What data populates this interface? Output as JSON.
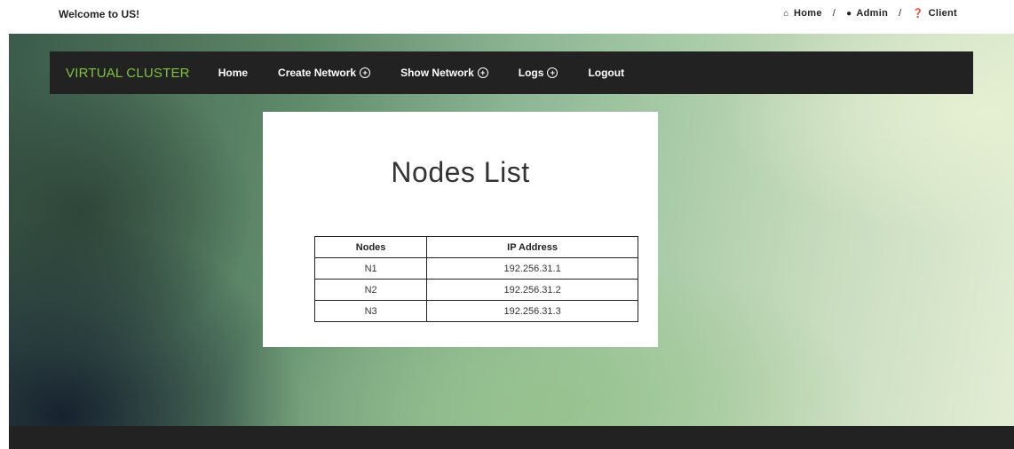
{
  "header": {
    "welcome": "Welcome to US!",
    "links": [
      {
        "icon": "home-icon",
        "glyph": "⌂",
        "label": "Home"
      },
      {
        "icon": "comments-icon",
        "glyph": "●",
        "label": "Admin"
      },
      {
        "icon": "question-icon",
        "glyph": "❓",
        "label": "Client"
      }
    ],
    "separator": "/"
  },
  "nav": {
    "brand": "VIRTUAL CLUSTER",
    "items": [
      {
        "label": "Home"
      },
      {
        "label": "Create Network"
      },
      {
        "label": "Show Network"
      },
      {
        "label": "Logs"
      },
      {
        "label": "Logout"
      }
    ],
    "plus_glyph": "+"
  },
  "panel": {
    "title": "Nodes List",
    "table": {
      "headers": [
        "Nodes",
        "IP Address"
      ],
      "rows": [
        [
          "N1",
          "192.256.31.1"
        ],
        [
          "N2",
          "192.256.31.2"
        ],
        [
          "N3",
          "192.256.31.3"
        ]
      ]
    }
  },
  "colors": {
    "brand": "#7ec242",
    "navbar": "#222222"
  }
}
